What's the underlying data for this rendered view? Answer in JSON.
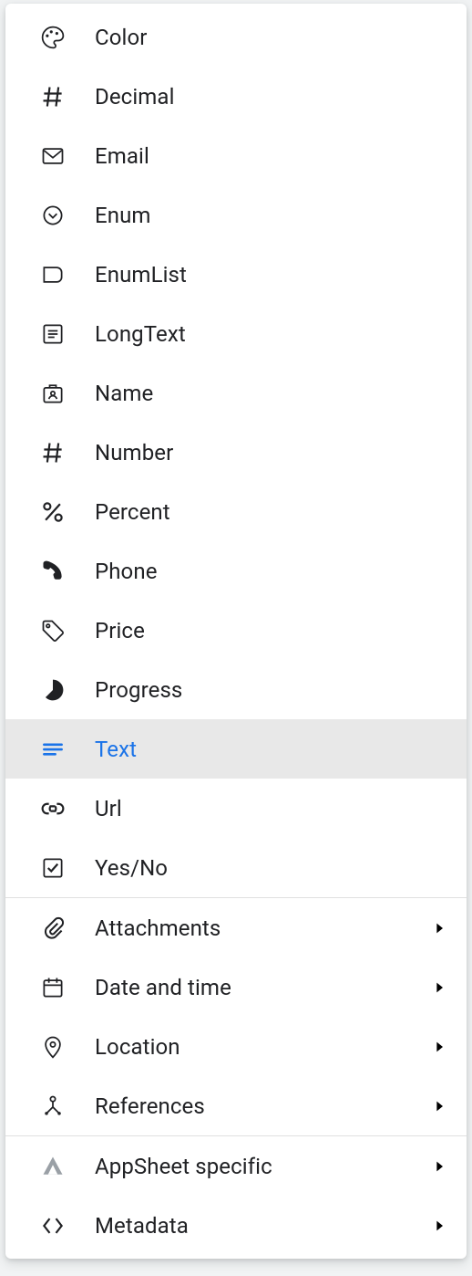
{
  "colors": {
    "accent": "#1a73e8",
    "text": "#3c4043",
    "selected_bg": "#e8eaed"
  },
  "menu": {
    "groups": [
      {
        "items": [
          {
            "icon": "palette-icon",
            "label": "Color",
            "submenu": false,
            "selected": false
          },
          {
            "icon": "hash-icon",
            "label": "Decimal",
            "submenu": false,
            "selected": false
          },
          {
            "icon": "email-icon",
            "label": "Email",
            "submenu": false,
            "selected": false
          },
          {
            "icon": "enum-icon",
            "label": "Enum",
            "submenu": false,
            "selected": false
          },
          {
            "icon": "enumlist-icon",
            "label": "EnumList",
            "submenu": false,
            "selected": false
          },
          {
            "icon": "longtext-icon",
            "label": "LongText",
            "submenu": false,
            "selected": false
          },
          {
            "icon": "name-icon",
            "label": "Name",
            "submenu": false,
            "selected": false
          },
          {
            "icon": "hash-icon",
            "label": "Number",
            "submenu": false,
            "selected": false
          },
          {
            "icon": "percent-icon",
            "label": "Percent",
            "submenu": false,
            "selected": false
          },
          {
            "icon": "phone-icon",
            "label": "Phone",
            "submenu": false,
            "selected": false
          },
          {
            "icon": "price-icon",
            "label": "Price",
            "submenu": false,
            "selected": false
          },
          {
            "icon": "progress-icon",
            "label": "Progress",
            "submenu": false,
            "selected": false
          },
          {
            "icon": "text-icon",
            "label": "Text",
            "submenu": false,
            "selected": true
          },
          {
            "icon": "url-icon",
            "label": "Url",
            "submenu": false,
            "selected": false
          },
          {
            "icon": "yesno-icon",
            "label": "Yes/No",
            "submenu": false,
            "selected": false
          }
        ]
      },
      {
        "items": [
          {
            "icon": "attachment-icon",
            "label": "Attachments",
            "submenu": true,
            "selected": false
          },
          {
            "icon": "calendar-icon",
            "label": "Date and time",
            "submenu": true,
            "selected": false
          },
          {
            "icon": "location-icon",
            "label": "Location",
            "submenu": true,
            "selected": false
          },
          {
            "icon": "references-icon",
            "label": "References",
            "submenu": true,
            "selected": false
          }
        ]
      },
      {
        "items": [
          {
            "icon": "appsheet-icon",
            "label": "AppSheet specific",
            "submenu": true,
            "selected": false
          },
          {
            "icon": "metadata-icon",
            "label": "Metadata",
            "submenu": true,
            "selected": false
          }
        ]
      }
    ]
  }
}
